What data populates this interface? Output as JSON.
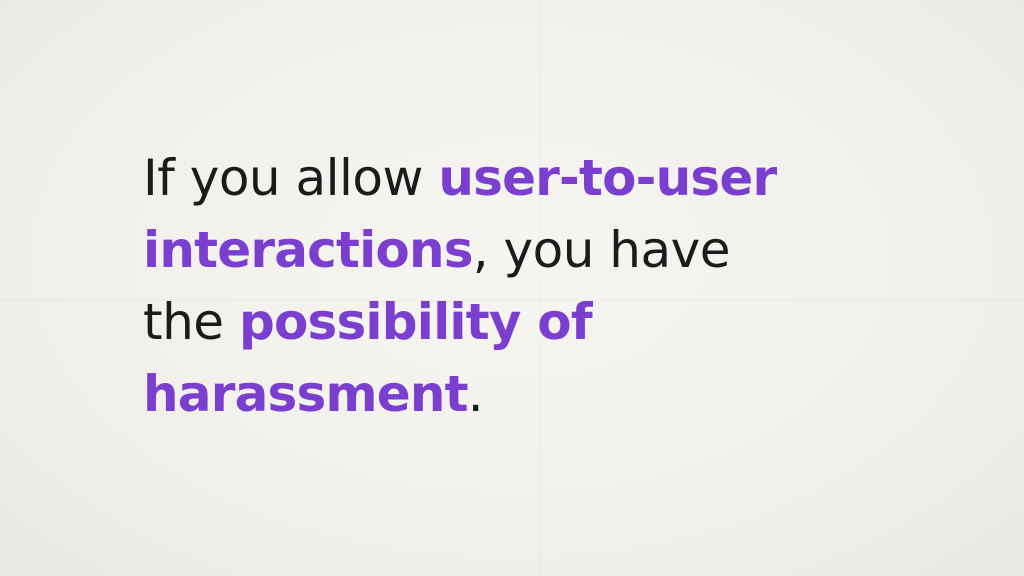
{
  "colors": {
    "text": "#1b1b1b",
    "highlight": "#7b3fd0",
    "background": "#f3f2ee"
  },
  "slide": {
    "lines": [
      [
        {
          "text": "If you allow ",
          "highlight": false
        },
        {
          "text": "user-to-user",
          "highlight": true
        }
      ],
      [
        {
          "text": "interactions",
          "highlight": true
        },
        {
          "text": ", you have",
          "highlight": false
        }
      ],
      [
        {
          "text": "the ",
          "highlight": false
        },
        {
          "text": "possibility of",
          "highlight": true
        }
      ],
      [
        {
          "text": "harassment",
          "highlight": true
        },
        {
          "text": ".",
          "highlight": false
        }
      ]
    ]
  }
}
